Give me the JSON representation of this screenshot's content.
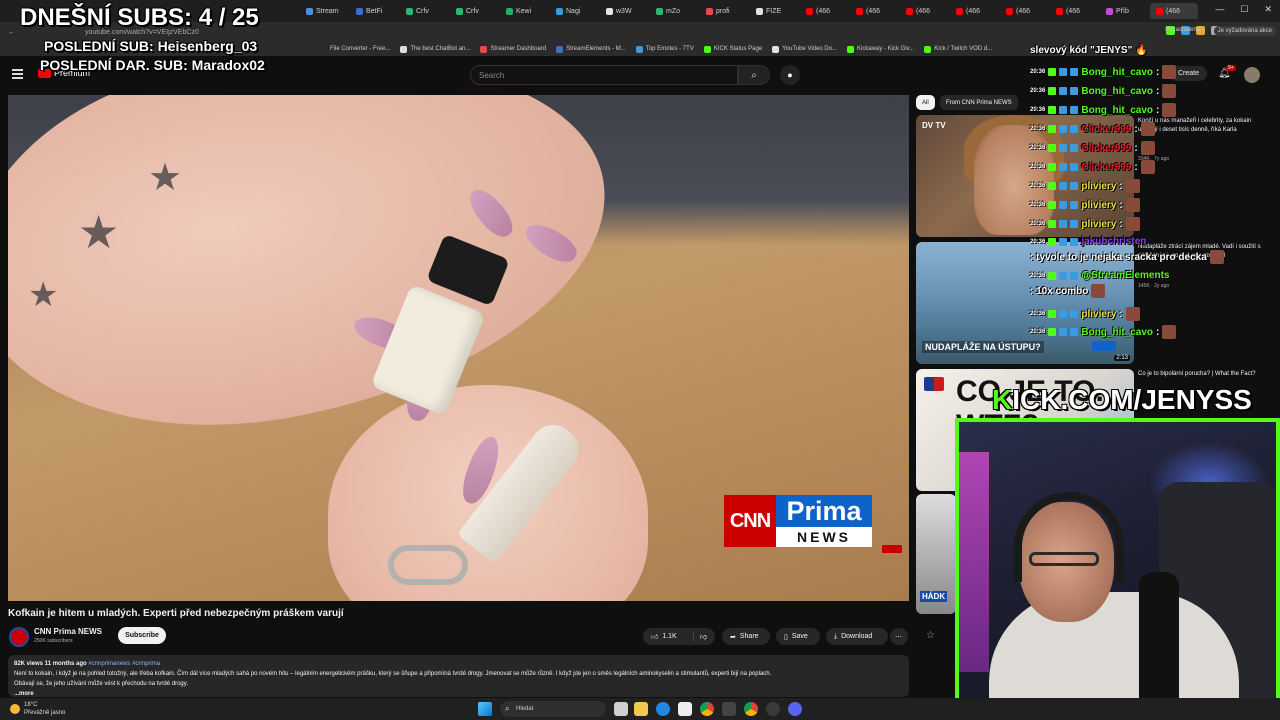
{
  "stream_overlay": {
    "subs_today": "DNEŠNÍ SUBS: 4 / 25",
    "last_sub": "POSLEDNÍ SUB: Heisenberg_03",
    "last_donation": "POSLEDNÍ DAR. SUB: Maradox02",
    "kick_url": "KICK.COM/JENYSS"
  },
  "browser": {
    "tabs": [
      "Stream",
      "BetFi",
      "Crfv",
      "Crfv",
      "Kewi",
      "Nagi",
      "w3W",
      "mZo",
      "profi",
      "FIZE",
      "(466",
      "(466",
      "(466",
      "(466",
      "(466",
      "(466",
      "Příb",
      "(466"
    ],
    "url": "youtube.com/watch?v=VEIjzVEbCz0",
    "profile": "Pozastaveno",
    "signed_status": "Je vyžadována akce",
    "bookmarks": [
      "File Converter - Free...",
      "The best ChatBot an...",
      "Streamer Dashboard",
      "StreamElements - M...",
      "Top Emotes - 7TV",
      "KICK Status Page",
      "YouTube Video Do...",
      "Kickaway - Kick Giv...",
      "Kick / Twitch VOD d..."
    ]
  },
  "youtube": {
    "logo_text": "Premium",
    "search_placeholder": "Search",
    "create_label": "Create",
    "notification_count": "9+",
    "video": {
      "logo_cnn": "CNN",
      "logo_prima": "Prima",
      "logo_news": "NEWS",
      "title": "Kofkain je hitem u mladých. Experti před nebezpečným práškem varují",
      "channel": "CNN Prima NEWS",
      "subscribers": "250K subscribers",
      "subscribe_label": "Subscribe",
      "likes": "1.1K",
      "share_label": "Share",
      "save_label": "Save",
      "download_label": "Download",
      "views_date": "82K views  11 months ago",
      "hashtags": "#cnnprimanews #cnnprima",
      "description_line1": "Není to kokain, i když je na pohled totožný, ale třeba kofkain. Čím dál více mladých sahá po novém hitu – legálním energetickém prášku, který se šňupe a připomíná tvrdé drogy. Jmenovat se může různě. I když jde jen o směs legálních aminokyselin a stimulantů, experti bijí na poplach.",
      "description_line2": "Obávají se, že jeho užívání může vést k přechodu na tvrdé drogy.",
      "more_label": "...more"
    },
    "sidebar": {
      "chips": [
        "All",
        "From CNN Prima NEWS"
      ],
      "items": [
        {
          "thumb_label": "DV TV",
          "title": "Končí u nás manažeři i celebrity, za kokain utrácejí i deset tisíc denně, říká Karla",
          "meta": "334K · 7y ago"
        },
        {
          "thumb_caption": "NUDAPLÁŽE NA ÚSTUPU?",
          "duration": "2:13",
          "title": "Nudapláže ztrácí zájem mladé. Vadí i soužití s oblečenými, popsal provozovatel",
          "meta": "145K · 2y ago"
        },
        {
          "thumb_text": "CO JE TO... WTF?",
          "title": "Co je to bipolární porucha? | What the Fact?",
          "meta": ""
        },
        {
          "thumb_label": "HÁDK",
          "title": "",
          "meta": ""
        }
      ]
    }
  },
  "chat": {
    "pinned": "slevový kód \"JENYS\" 🔥",
    "messages": [
      {
        "time": "20:36",
        "user": "Bong_hit_cavo",
        "color": "#53fc18",
        "text": ":"
      },
      {
        "time": "20:36",
        "user": "Bong_hit_cavo",
        "color": "#53fc18",
        "text": ":"
      },
      {
        "time": "20:36",
        "user": "Bong_hit_cavo",
        "color": "#53fc18",
        "text": ":"
      },
      {
        "time": "20:36",
        "user": "Clicker999",
        "color": "#e0202a",
        "text": ":"
      },
      {
        "time": "20:36",
        "user": "Clicker999",
        "color": "#e0202a",
        "text": ":"
      },
      {
        "time": "20:36",
        "user": "Clicker999",
        "color": "#e0202a",
        "text": ":"
      },
      {
        "time": "20:36",
        "user": "pliviery",
        "color": "#e8e04a",
        "text": ":"
      },
      {
        "time": "20:36",
        "user": "pliviery",
        "color": "#e8e04a",
        "text": ":"
      },
      {
        "time": "20:36",
        "user": "pliviery",
        "color": "#e8e04a",
        "text": ":"
      },
      {
        "time": "20:36",
        "user": "jakubchristen",
        "color": "#8a3cf2",
        "text": ": tyvole to je nejaka sracka pro decka"
      },
      {
        "time": "20:36",
        "user": "@StreamElements",
        "color": "#53fc18",
        "text": ": 10x combo"
      },
      {
        "time": "20:36",
        "user": "pliviery",
        "color": "#e8e04a",
        "text": ":"
      },
      {
        "time": "20:36",
        "user": "Bong_hit_cavo",
        "color": "#53fc18",
        "text": ":"
      }
    ]
  },
  "taskbar": {
    "temperature": "18°C",
    "weather": "Převážně jasno",
    "search_placeholder": "Hledat"
  },
  "colors": {
    "kick_green": "#53fc18",
    "youtube_red": "#ff0000",
    "cnn_red": "#cc0000",
    "prima_blue": "#0d63c9"
  }
}
